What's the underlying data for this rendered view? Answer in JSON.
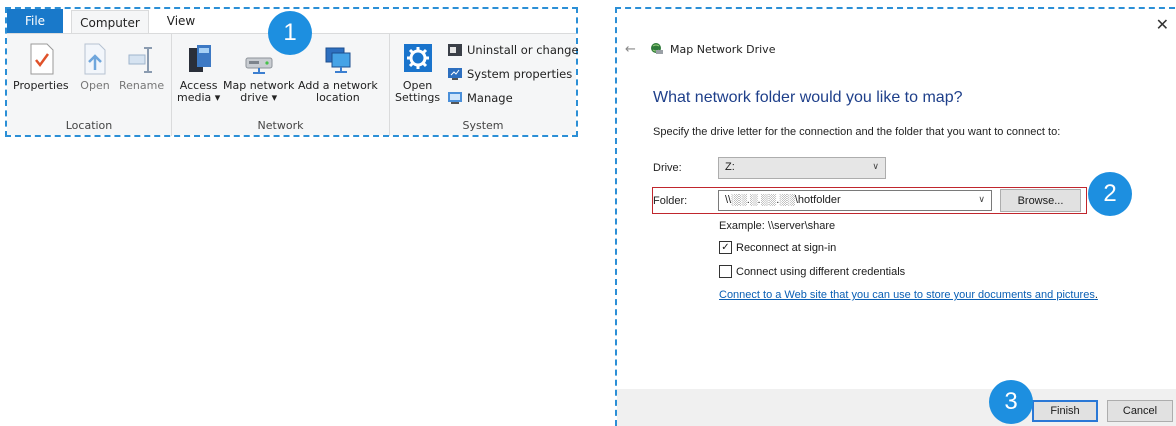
{
  "ribbon": {
    "tabs": [
      "File",
      "Computer",
      "View"
    ],
    "groups": {
      "location": {
        "label": "Location",
        "buttons": [
          {
            "line1": "Properties",
            "line2": ""
          },
          {
            "line1": "Open",
            "line2": ""
          },
          {
            "line1": "Rename",
            "line2": ""
          }
        ]
      },
      "network": {
        "label": "Network",
        "buttons": [
          {
            "line1": "Access",
            "line2": "media ▾"
          },
          {
            "line1": "Map network",
            "line2": "drive ▾"
          },
          {
            "line1": "Add a network",
            "line2": "location"
          }
        ]
      },
      "system": {
        "label": "System",
        "open_settings": {
          "line1": "Open",
          "line2": "Settings"
        },
        "commands": [
          "Uninstall or change",
          "System properties",
          "Manage"
        ]
      }
    }
  },
  "dialog": {
    "title": "Map Network Drive",
    "close": "✕",
    "back": "←",
    "heading": "What network folder would you like to map?",
    "instruction": "Specify the drive letter for the connection and the folder that you want to connect to:",
    "drive_label": "Drive:",
    "drive_value": "Z:",
    "folder_label": "Folder:",
    "folder_value": "\\\\░░.░.░░.░░\\hotfolder",
    "browse": "Browse...",
    "example": "Example: \\\\server\\share",
    "reconnect": "Reconnect at sign-in",
    "reconnect_checked": true,
    "different_credentials": "Connect using different credentials",
    "different_credentials_checked": false,
    "link": "Connect to a Web site that you can use to store your documents and pictures",
    "link_suffix": ".",
    "finish": "Finish",
    "cancel": "Cancel"
  },
  "callouts": [
    "1",
    "2",
    "3"
  ],
  "colors": {
    "accent": "#1d8fe0",
    "file_tab": "#1979ca",
    "heading": "#1e3f8a",
    "highlight_border": "#c0262d",
    "link": "#0a5fb4"
  }
}
